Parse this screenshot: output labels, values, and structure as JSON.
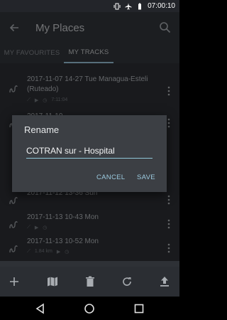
{
  "status_bar": {
    "time": "07:00:10"
  },
  "app_bar": {
    "title": "My Places"
  },
  "tabs": [
    {
      "label": "MY FAVOURITES"
    },
    {
      "label": "MY TRACKS"
    }
  ],
  "tracks": [
    {
      "title": "2017-11-07 14-27 Tue Managua-Esteli (Ruteado)",
      "dist": "",
      "time": "",
      "dur": "7:11:04"
    },
    {
      "title": "2017-11-10",
      "dist": "",
      "time": "",
      "dur": ""
    },
    {
      "title": "2017-11-12 13-36 Sun",
      "dist": "",
      "time": "",
      "dur": ""
    },
    {
      "title": "2017-11-13 10-43 Mon",
      "dist": "",
      "time": "",
      "dur": ""
    },
    {
      "title": "2017-11-13 10-52 Mon",
      "dist": "1.84 km",
      "time": "",
      "dur": ""
    }
  ],
  "dialog": {
    "title": "Rename",
    "value": "COTRAN sur - Hospital",
    "cancel": "CANCEL",
    "save": "SAVE"
  },
  "colors": {
    "accent": "#9ccbe0",
    "background": "#2e3136",
    "dialog": "#3c3f44"
  }
}
